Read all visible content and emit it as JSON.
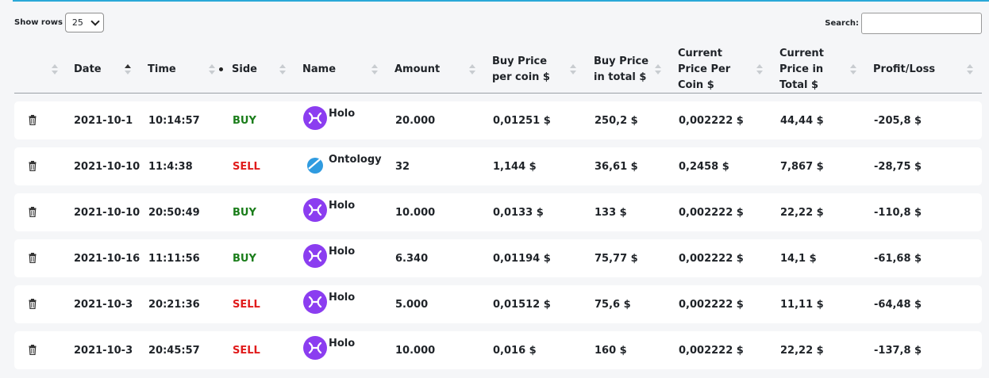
{
  "controls": {
    "show_rows_label": "Show rows",
    "rows_value": "25",
    "search_label": "Search:",
    "search_value": ""
  },
  "columns": [
    {
      "id": "actions",
      "label": ""
    },
    {
      "id": "date",
      "label": "Date"
    },
    {
      "id": "time",
      "label": "Time"
    },
    {
      "id": "side",
      "label": "Side"
    },
    {
      "id": "name",
      "label": "Name"
    },
    {
      "id": "amount",
      "label": "Amount"
    },
    {
      "id": "buy_price_per_coin",
      "label": "Buy Price per coin $"
    },
    {
      "id": "buy_price_total",
      "label": "Buy Price in total $"
    },
    {
      "id": "current_price_per_coin",
      "label": "Current Price Per Coin $"
    },
    {
      "id": "current_price_total",
      "label": "Current Price in Total $"
    },
    {
      "id": "profit_loss",
      "label": "Profit/Loss"
    }
  ],
  "colors": {
    "buy": "#1a7d1a",
    "sell": "#e01b1b",
    "holo": "#8b3df0",
    "ontology": "#2f9be0"
  },
  "rows": [
    {
      "date": "2021-10-1",
      "time": "10:14:57",
      "side": "BUY",
      "coin": "Holo",
      "icon": "holo-icon",
      "amount": "20.000",
      "buy_per_coin": "0,01251 $",
      "buy_total": "250,2 $",
      "cur_per_coin": "0,002222 $",
      "cur_total": "44,44 $",
      "pl": "-205,8 $"
    },
    {
      "date": "2021-10-10",
      "time": "11:4:38",
      "side": "SELL",
      "coin": "Ontology",
      "icon": "ontology-icon",
      "amount": "32",
      "buy_per_coin": "1,144 $",
      "buy_total": "36,61 $",
      "cur_per_coin": "0,2458 $",
      "cur_total": "7,867 $",
      "pl": "-28,75 $"
    },
    {
      "date": "2021-10-10",
      "time": "20:50:49",
      "side": "BUY",
      "coin": "Holo",
      "icon": "holo-icon",
      "amount": "10.000",
      "buy_per_coin": "0,0133 $",
      "buy_total": "133 $",
      "cur_per_coin": "0,002222 $",
      "cur_total": "22,22 $",
      "pl": "-110,8 $"
    },
    {
      "date": "2021-10-16",
      "time": "11:11:56",
      "side": "BUY",
      "coin": "Holo",
      "icon": "holo-icon",
      "amount": "6.340",
      "buy_per_coin": "0,01194 $",
      "buy_total": "75,77 $",
      "cur_per_coin": "0,002222 $",
      "cur_total": "14,1 $",
      "pl": "-61,68 $"
    },
    {
      "date": "2021-10-3",
      "time": "20:21:36",
      "side": "SELL",
      "coin": "Holo",
      "icon": "holo-icon",
      "amount": "5.000",
      "buy_per_coin": "0,01512 $",
      "buy_total": "75,6 $",
      "cur_per_coin": "0,002222 $",
      "cur_total": "11,11 $",
      "pl": "-64,48 $"
    },
    {
      "date": "2021-10-3",
      "time": "20:45:57",
      "side": "SELL",
      "coin": "Holo",
      "icon": "holo-icon",
      "amount": "10.000",
      "buy_per_coin": "0,016 $",
      "buy_total": "160 $",
      "cur_per_coin": "0,002222 $",
      "cur_total": "22,22 $",
      "pl": "-137,8 $"
    }
  ]
}
